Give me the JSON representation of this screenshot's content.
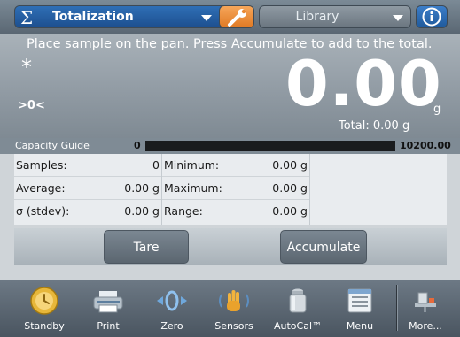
{
  "header": {
    "app_name": "Totalization",
    "library_label": "Library"
  },
  "display": {
    "instruction": "Place sample on the pan.  Press Accumulate to add to the total.",
    "stable_indicator": "*",
    "zero_indicator": ">0<",
    "weight": "0.00",
    "unit": "g",
    "total": "Total: 0.00 g"
  },
  "capacity": {
    "label": "Capacity Guide",
    "min": "0",
    "max": "10200.00",
    "fill_fraction": 0
  },
  "stats": {
    "left": [
      {
        "label": "Samples:",
        "value": "0"
      },
      {
        "label": "Average:",
        "value": "0.00 g"
      },
      {
        "label": "σ (stdev):",
        "value": "0.00 g"
      }
    ],
    "right": [
      {
        "label": "Minimum:",
        "value": "0.00 g"
      },
      {
        "label": "Maximum:",
        "value": "0.00 g"
      },
      {
        "label": "Range:",
        "value": "0.00 g"
      }
    ]
  },
  "actions": {
    "tare": "Tare",
    "accumulate": "Accumulate"
  },
  "nav": [
    {
      "label": "Standby",
      "icon": "standby-icon"
    },
    {
      "label": "Print",
      "icon": "printer-icon"
    },
    {
      "label": "Zero",
      "icon": "zero-icon"
    },
    {
      "label": "Sensors",
      "icon": "hand-sensor-icon"
    },
    {
      "label": "AutoCal™",
      "icon": "calibration-weight-icon"
    },
    {
      "label": "Menu",
      "icon": "menu-icon"
    },
    {
      "label": "More...",
      "icon": "more-icon"
    }
  ],
  "colors": {
    "app_button": "#2f6fb6",
    "wrench_button": "#f0923e",
    "info_button": "#3c7ec9"
  }
}
